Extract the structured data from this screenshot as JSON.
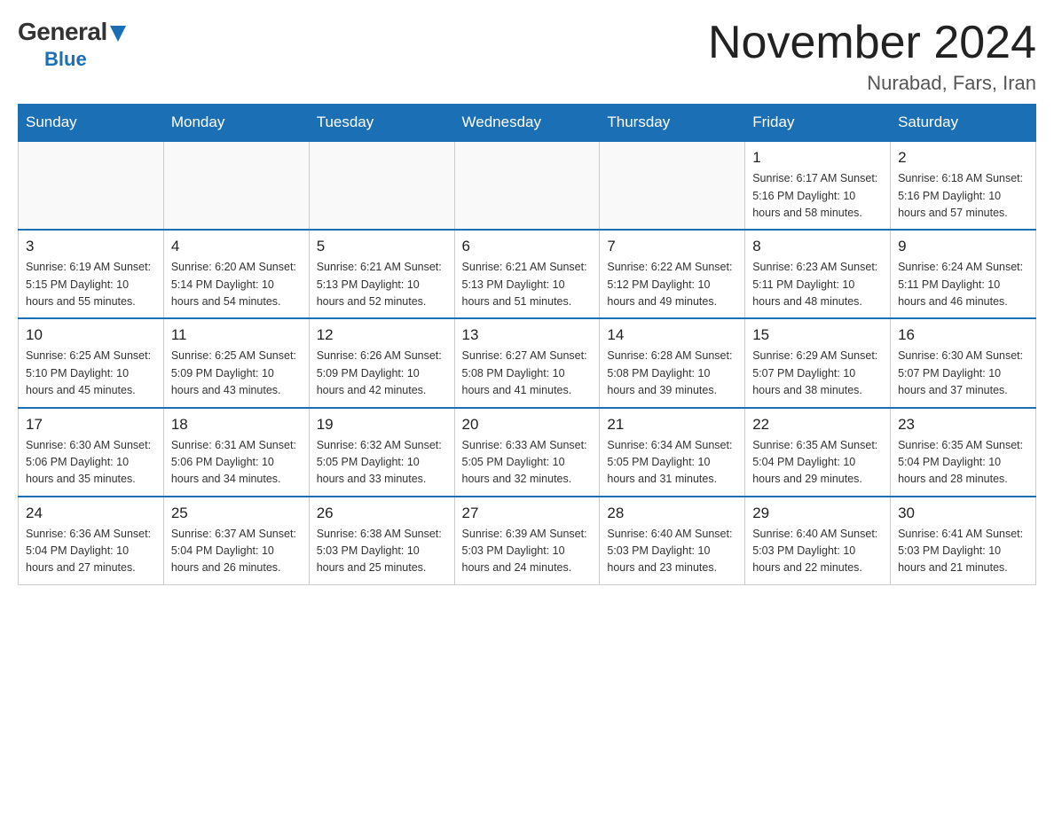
{
  "header": {
    "logo": {
      "general": "General",
      "blue": "Blue"
    },
    "title": "November 2024",
    "location": "Nurabad, Fars, Iran"
  },
  "days_of_week": [
    "Sunday",
    "Monday",
    "Tuesday",
    "Wednesday",
    "Thursday",
    "Friday",
    "Saturday"
  ],
  "weeks": [
    {
      "days": [
        {
          "num": "",
          "info": ""
        },
        {
          "num": "",
          "info": ""
        },
        {
          "num": "",
          "info": ""
        },
        {
          "num": "",
          "info": ""
        },
        {
          "num": "",
          "info": ""
        },
        {
          "num": "1",
          "info": "Sunrise: 6:17 AM\nSunset: 5:16 PM\nDaylight: 10 hours\nand 58 minutes."
        },
        {
          "num": "2",
          "info": "Sunrise: 6:18 AM\nSunset: 5:16 PM\nDaylight: 10 hours\nand 57 minutes."
        }
      ]
    },
    {
      "days": [
        {
          "num": "3",
          "info": "Sunrise: 6:19 AM\nSunset: 5:15 PM\nDaylight: 10 hours\nand 55 minutes."
        },
        {
          "num": "4",
          "info": "Sunrise: 6:20 AM\nSunset: 5:14 PM\nDaylight: 10 hours\nand 54 minutes."
        },
        {
          "num": "5",
          "info": "Sunrise: 6:21 AM\nSunset: 5:13 PM\nDaylight: 10 hours\nand 52 minutes."
        },
        {
          "num": "6",
          "info": "Sunrise: 6:21 AM\nSunset: 5:13 PM\nDaylight: 10 hours\nand 51 minutes."
        },
        {
          "num": "7",
          "info": "Sunrise: 6:22 AM\nSunset: 5:12 PM\nDaylight: 10 hours\nand 49 minutes."
        },
        {
          "num": "8",
          "info": "Sunrise: 6:23 AM\nSunset: 5:11 PM\nDaylight: 10 hours\nand 48 minutes."
        },
        {
          "num": "9",
          "info": "Sunrise: 6:24 AM\nSunset: 5:11 PM\nDaylight: 10 hours\nand 46 minutes."
        }
      ]
    },
    {
      "days": [
        {
          "num": "10",
          "info": "Sunrise: 6:25 AM\nSunset: 5:10 PM\nDaylight: 10 hours\nand 45 minutes."
        },
        {
          "num": "11",
          "info": "Sunrise: 6:25 AM\nSunset: 5:09 PM\nDaylight: 10 hours\nand 43 minutes."
        },
        {
          "num": "12",
          "info": "Sunrise: 6:26 AM\nSunset: 5:09 PM\nDaylight: 10 hours\nand 42 minutes."
        },
        {
          "num": "13",
          "info": "Sunrise: 6:27 AM\nSunset: 5:08 PM\nDaylight: 10 hours\nand 41 minutes."
        },
        {
          "num": "14",
          "info": "Sunrise: 6:28 AM\nSunset: 5:08 PM\nDaylight: 10 hours\nand 39 minutes."
        },
        {
          "num": "15",
          "info": "Sunrise: 6:29 AM\nSunset: 5:07 PM\nDaylight: 10 hours\nand 38 minutes."
        },
        {
          "num": "16",
          "info": "Sunrise: 6:30 AM\nSunset: 5:07 PM\nDaylight: 10 hours\nand 37 minutes."
        }
      ]
    },
    {
      "days": [
        {
          "num": "17",
          "info": "Sunrise: 6:30 AM\nSunset: 5:06 PM\nDaylight: 10 hours\nand 35 minutes."
        },
        {
          "num": "18",
          "info": "Sunrise: 6:31 AM\nSunset: 5:06 PM\nDaylight: 10 hours\nand 34 minutes."
        },
        {
          "num": "19",
          "info": "Sunrise: 6:32 AM\nSunset: 5:05 PM\nDaylight: 10 hours\nand 33 minutes."
        },
        {
          "num": "20",
          "info": "Sunrise: 6:33 AM\nSunset: 5:05 PM\nDaylight: 10 hours\nand 32 minutes."
        },
        {
          "num": "21",
          "info": "Sunrise: 6:34 AM\nSunset: 5:05 PM\nDaylight: 10 hours\nand 31 minutes."
        },
        {
          "num": "22",
          "info": "Sunrise: 6:35 AM\nSunset: 5:04 PM\nDaylight: 10 hours\nand 29 minutes."
        },
        {
          "num": "23",
          "info": "Sunrise: 6:35 AM\nSunset: 5:04 PM\nDaylight: 10 hours\nand 28 minutes."
        }
      ]
    },
    {
      "days": [
        {
          "num": "24",
          "info": "Sunrise: 6:36 AM\nSunset: 5:04 PM\nDaylight: 10 hours\nand 27 minutes."
        },
        {
          "num": "25",
          "info": "Sunrise: 6:37 AM\nSunset: 5:04 PM\nDaylight: 10 hours\nand 26 minutes."
        },
        {
          "num": "26",
          "info": "Sunrise: 6:38 AM\nSunset: 5:03 PM\nDaylight: 10 hours\nand 25 minutes."
        },
        {
          "num": "27",
          "info": "Sunrise: 6:39 AM\nSunset: 5:03 PM\nDaylight: 10 hours\nand 24 minutes."
        },
        {
          "num": "28",
          "info": "Sunrise: 6:40 AM\nSunset: 5:03 PM\nDaylight: 10 hours\nand 23 minutes."
        },
        {
          "num": "29",
          "info": "Sunrise: 6:40 AM\nSunset: 5:03 PM\nDaylight: 10 hours\nand 22 minutes."
        },
        {
          "num": "30",
          "info": "Sunrise: 6:41 AM\nSunset: 5:03 PM\nDaylight: 10 hours\nand 21 minutes."
        }
      ]
    }
  ]
}
